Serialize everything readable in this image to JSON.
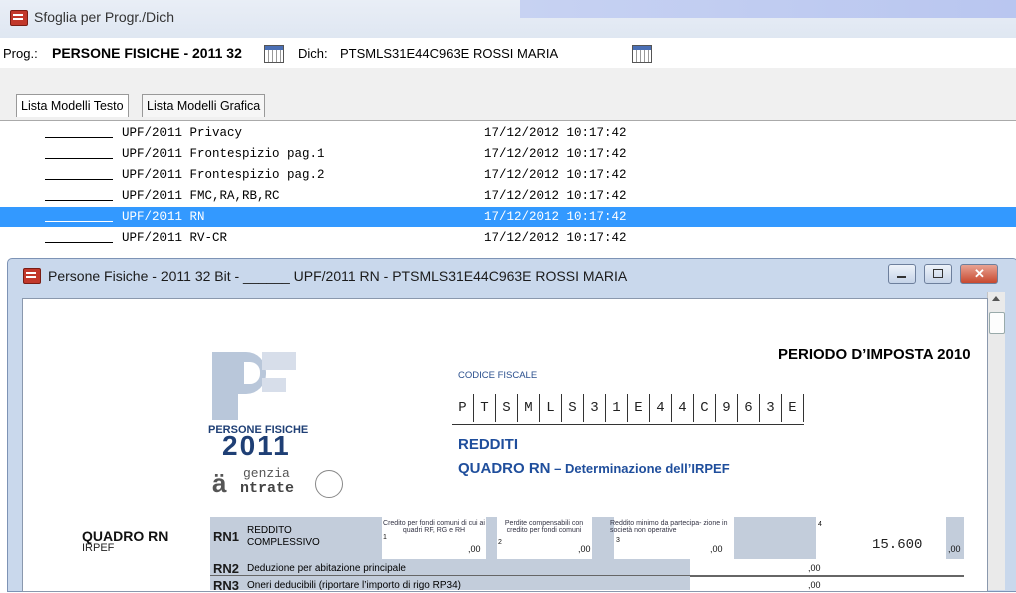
{
  "outer_window": {
    "title": "Sfoglia per Progr./Dich"
  },
  "info_bar": {
    "prog_label": "Prog.:",
    "prog_value": "PERSONE FISICHE - 2011 32",
    "dich_label": "Dich:",
    "dich_value": "PTSMLS31E44C963E ROSSI MARIA"
  },
  "tabs": [
    {
      "label": "Lista Modelli Testo"
    },
    {
      "label": "Lista Modelli Grafica"
    }
  ],
  "list_rows": [
    {
      "name": "UPF/2011 Privacy",
      "date": "17/12/2012 10:17:42"
    },
    {
      "name": "UPF/2011 Frontespizio pag.1",
      "date": "17/12/2012 10:17:42"
    },
    {
      "name": "UPF/2011 Frontespizio pag.2",
      "date": "17/12/2012 10:17:42"
    },
    {
      "name": "UPF/2011 FMC,RA,RB,RC",
      "date": "17/12/2012 10:17:42"
    },
    {
      "name": "UPF/2011 RN",
      "date": "17/12/2012 10:17:42",
      "selected": true
    },
    {
      "name": "UPF/2011 RV-CR",
      "date": "17/12/2012 10:17:42"
    }
  ],
  "inner_window": {
    "title": "Persone Fisiche - 2011 32 Bit - ______ UPF/2011 RN - PTSMLS31E44C963E ROSSI MARIA"
  },
  "form": {
    "logo_line1": "PERSONE FISICHE",
    "logo_year": "2011",
    "logo_agency_a": "genzia",
    "logo_agency_b": "ntrate",
    "periodo": "PERIODO D’IMPOSTA 2010",
    "codice_label": "CODICE FISCALE",
    "codice_chars": [
      "P",
      "T",
      "S",
      "M",
      "L",
      "S",
      "3",
      "1",
      "E",
      "4",
      "4",
      "C",
      "9",
      "6",
      "3",
      "E"
    ],
    "redditi": "REDDITI",
    "quadro_title": "QUADRO RN",
    "quadro_sub": " – Determinazione dell’IRPEF",
    "side_title": "QUADRO RN",
    "side_sub": "IRPEF",
    "rn1_code": "RN1",
    "rn1_label_a": "REDDITO",
    "rn1_label_b": "COMPLESSIVO",
    "rn1_col1": "Credito per fondi comuni di cui ai quadri RF, RG e RH",
    "rn1_col2": "Perdite compensabili con credito per fondi comuni",
    "rn1_col3": "Reddito minimo da partecipa- zione in società non operative",
    "rn1_n1": "1",
    "rn1_n2": "2",
    "rn1_n3": "3",
    "rn1_n4": "4",
    "zero": ",00",
    "rn1_total": "15.600",
    "rn2_code": "RN2",
    "rn2_label": "Deduzione per abitazione principale",
    "rn3_code": "RN3",
    "rn3_label": "Oneri deducibili (riportare l’importo di rigo RP34)"
  },
  "colors": {
    "selection": "#3399ff",
    "form_blue": "#1f4e9c",
    "form_grey": "#c3cddb"
  }
}
